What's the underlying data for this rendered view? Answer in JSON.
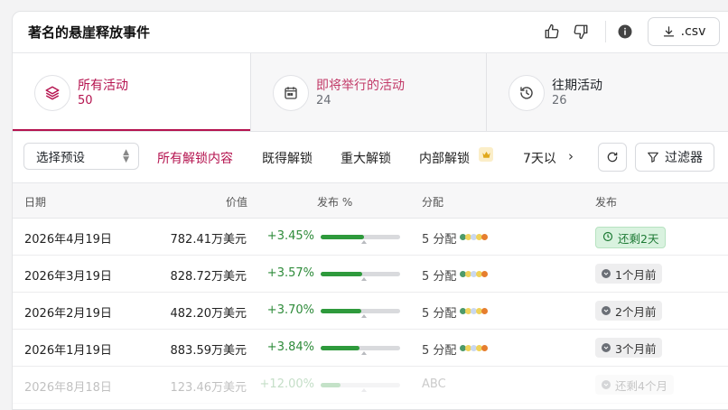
{
  "header": {
    "title": "著名的悬崖释放事件",
    "csv_label": ".csv"
  },
  "tabs": [
    {
      "label": "所有活动",
      "count": "50",
      "icon": "layers-icon"
    },
    {
      "label": "即将举行的活动",
      "count": "24",
      "icon": "calendar-icon"
    },
    {
      "label": "往期活动",
      "count": "26",
      "icon": "history-icon"
    }
  ],
  "toolbar": {
    "preset": "选择预设",
    "filters": [
      "所有解锁内容",
      "既得解锁",
      "重大解锁",
      "内部解锁",
      "7天以"
    ],
    "filter_button": "过滤器"
  },
  "table": {
    "columns": [
      "日期",
      "价值",
      "发布 %",
      "分配",
      "发布"
    ],
    "rows": [
      {
        "date": "2026年4月19日",
        "value": "782.41万美元",
        "pct": "+3.45%",
        "fill": 0.54,
        "alloc": "5 分配",
        "status": "还剩2天",
        "highlight": true
      },
      {
        "date": "2026年3月19日",
        "value": "828.72万美元",
        "pct": "+3.57%",
        "fill": 0.52,
        "alloc": "5 分配",
        "status": "1个月前",
        "highlight": false
      },
      {
        "date": "2026年2月19日",
        "value": "482.20万美元",
        "pct": "+3.70%",
        "fill": 0.51,
        "alloc": "5 分配",
        "status": "2个月前",
        "highlight": false
      },
      {
        "date": "2026年1月19日",
        "value": "883.59万美元",
        "pct": "+3.84%",
        "fill": 0.49,
        "alloc": "5 分配",
        "status": "3个月前",
        "highlight": false
      },
      {
        "date": "2026年8月18日",
        "value": "123.46万美元",
        "pct": "+12.00%",
        "fill": 0.25,
        "alloc": "ABC",
        "status": "还剩4个月",
        "highlight": false
      }
    ]
  },
  "colors": {
    "accent": "#b5134f",
    "positive": "#2e8b3a",
    "dots": [
      "#4d9a6a",
      "#f0d35a",
      "#c9d8f0",
      "#f0d35a",
      "#e67e2e"
    ]
  }
}
